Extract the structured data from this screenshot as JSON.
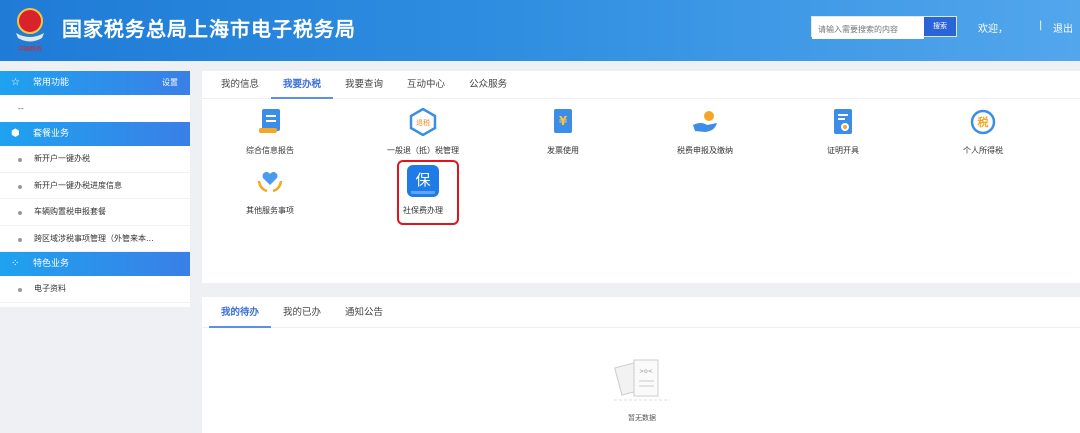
{
  "header": {
    "title": "国家税务总局上海市电子税务局",
    "emblem_text": "中国税务",
    "search_placeholder": "请输入需要搜索的内容",
    "search_button": "搜索",
    "welcome": "欢迎，",
    "separator": "|",
    "logout": "退出"
  },
  "sidebar": {
    "common": {
      "title": "常用功能",
      "settings": "设置",
      "empty": "--"
    },
    "package": {
      "title": "套餐业务",
      "items": [
        "新开户一键办税",
        "新开户一键办税进度信息",
        "车辆购置税申报套餐",
        "跨区域涉税事项管理（外管来本..."
      ]
    },
    "special": {
      "title": "特色业务",
      "items": [
        "电子资料"
      ]
    }
  },
  "main": {
    "tabs": [
      "我的信息",
      "我要办税",
      "我要查询",
      "互动中心",
      "公众服务"
    ],
    "active_tab": "我要办税",
    "services": [
      "综合信息报告",
      "一般退（抵）税管理",
      "发票使用",
      "税费申报及缴纳",
      "证明开具",
      "个人所得税",
      "其他服务事项",
      "社保费办理"
    ],
    "icon_text": {
      "refund": "退税",
      "invoice": "¥",
      "iit": "税",
      "social": "保"
    }
  },
  "tasks": {
    "tabs": [
      "我的待办",
      "我的已办",
      "通知公告"
    ],
    "active_tab": "我的待办",
    "empty_text": "暂无数据"
  }
}
